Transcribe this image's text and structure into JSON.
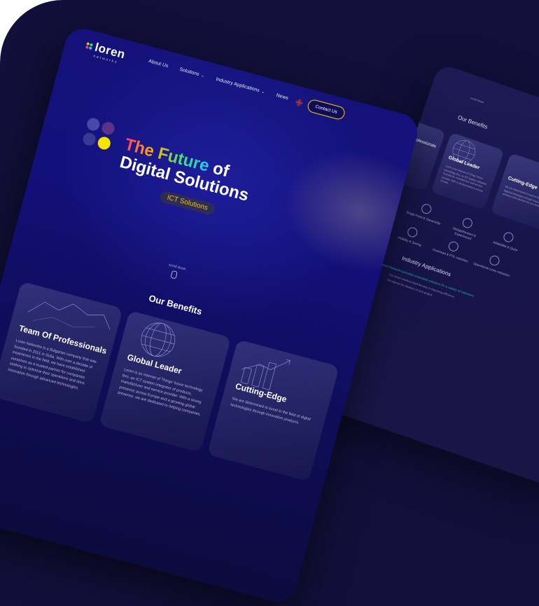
{
  "brand": {
    "name": "loren",
    "tagline": "networks",
    "dot_colors": [
      "#ffb300",
      "#35e07a",
      "#ff3b6b",
      "#20c8ff"
    ]
  },
  "nav": {
    "items": [
      {
        "label": "About Us",
        "has_dropdown": false
      },
      {
        "label": "Solutions",
        "has_dropdown": true
      },
      {
        "label": "Industry Applications",
        "has_dropdown": true
      },
      {
        "label": "News",
        "has_dropdown": false
      }
    ],
    "contact_label": "Contact Us",
    "language_icon": "uk-flag-icon"
  },
  "hero": {
    "title_highlight": "The Future",
    "title_rest": "of",
    "title_line2": "Digital Solutions",
    "pill": "ICT Solutions",
    "scroll_label": "scroll down"
  },
  "benefits": {
    "title": "Our Benefits",
    "cards": [
      {
        "title": "Team Of Professionals",
        "text": "Loren Networks is a Bulgarian company that was founded in 2011 in Sofia. With over a decade of experience in the field, we have established ourselves as a trusted partner for companies seeking to optimize their operations and drive innovation through advanced technologies."
      },
      {
        "title": "Global Leader",
        "text": "Loren is an Internet of Things' future technology firm, an ICT system integrator of products, manufacturer and service provider. With a strong presence across Europe and a growing global presence, we are dedicated to helping companies."
      },
      {
        "title": "Cutting-Edge",
        "text": "We are determined to excel in the field of digital technologies through innovative products."
      }
    ]
  },
  "back_page": {
    "scroll_label": "scroll down",
    "benefits_title": "Our Benefits",
    "card_left_label": "ofessionals",
    "cards": [
      {
        "title": "Global Leader",
        "text": "Loren is an Internet of Things' future technology firm, an ICT system integrator of products, manufacturer and service provider. With a strong presence across Europe."
      },
      {
        "title": "Cutting-Edge",
        "text": "We are determined to excel in the field of digital technologies through innovative products and solutions for our clients."
      }
    ],
    "features": [
      {
        "label": "Single-Point & Ownership"
      },
      {
        "label": "Straightforward & Experienced"
      },
      {
        "label": "Adaptable & Quick"
      },
      {
        "label": "Visibility & Saving"
      },
      {
        "label": "Overhead & FTE reduction"
      },
      {
        "label": "Operational costs reduction"
      }
    ],
    "industry_title": "Industry Applications",
    "industry_sub": "Loren Networks provides innovative solutions for a variety of industries",
    "industry_body": "Our smart solutions lead the way in improving efficiency",
    "industry_body2": "throughout the duration of your project"
  },
  "colors": {
    "background": "#120f3a",
    "accent_yellow": "#f5c400",
    "teal": "#19b7a4"
  }
}
